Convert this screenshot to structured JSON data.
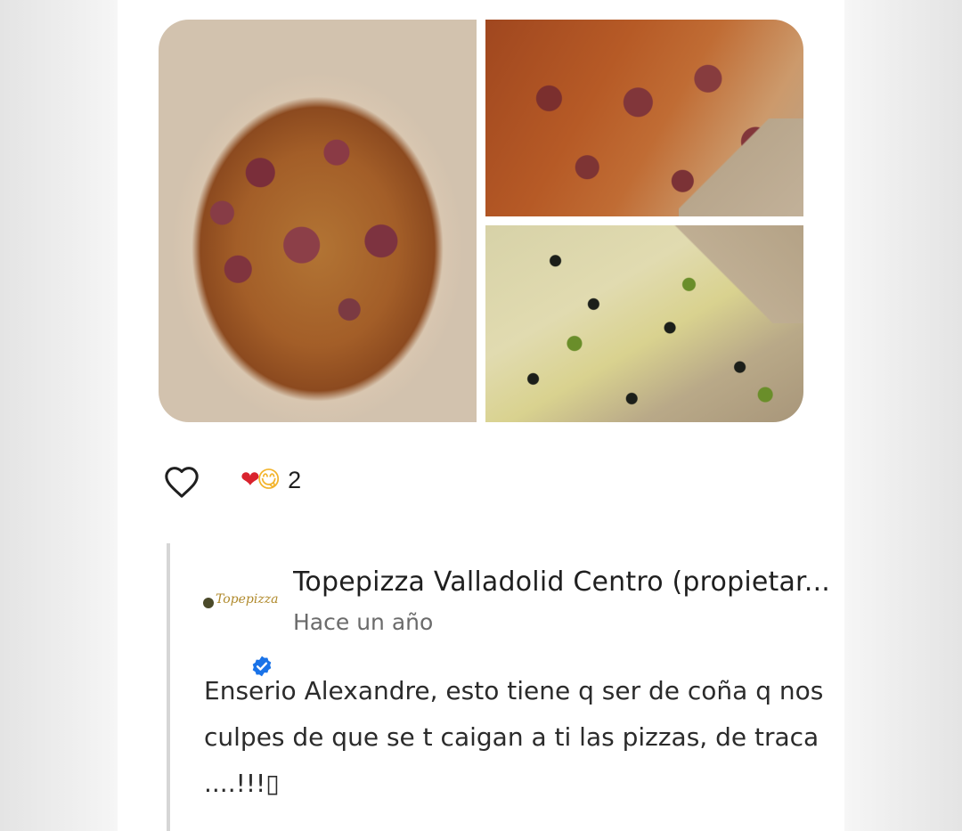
{
  "photos": [
    {
      "name": "pizza-photo-bbq"
    },
    {
      "name": "pizza-photo-ham"
    },
    {
      "name": "pizza-photo-olives"
    }
  ],
  "reactions": {
    "emojis": [
      "❤",
      "😋"
    ],
    "count": "2",
    "colors": {
      "heart": "#d9232e",
      "face": "#f3b42b"
    }
  },
  "reply": {
    "logo_text": "Topepizza",
    "owner_name": "Topepizza Valladolid Centro (propietar...",
    "time": "Hace un año",
    "text": "Enserio Alexandre, esto tiene q ser de coña q nos culpes de que se t caigan a ti las pizzas, de traca ....!!!▯"
  },
  "colors": {
    "verified": "#1a73e8",
    "divider": "#d6d6d6"
  }
}
